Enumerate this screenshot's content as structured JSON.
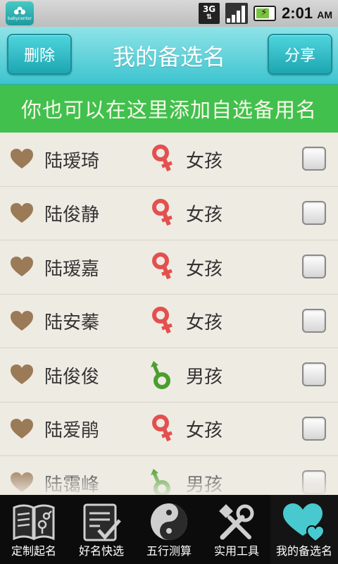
{
  "status": {
    "network": "3G",
    "time": "2:01",
    "ampm": "AM",
    "app_icon_text": "babycenter"
  },
  "header": {
    "delete_label": "删除",
    "title": "我的备选名",
    "share_label": "分享"
  },
  "banner": {
    "text": "你也可以在这里添加自选备用名"
  },
  "names": [
    {
      "name": "陆瑷琦",
      "gender": "女孩",
      "gender_icon": "female-symbol-icon",
      "checked": false
    },
    {
      "name": "陆俊静",
      "gender": "女孩",
      "gender_icon": "female-symbol-icon",
      "checked": false
    },
    {
      "name": "陆瑷嘉",
      "gender": "女孩",
      "gender_icon": "female-symbol-icon",
      "checked": false
    },
    {
      "name": "陆安蓁",
      "gender": "女孩",
      "gender_icon": "female-symbol-icon",
      "checked": false
    },
    {
      "name": "陆俊俊",
      "gender": "男孩",
      "gender_icon": "male-symbol-icon",
      "checked": false
    },
    {
      "name": "陆爱鹃",
      "gender": "女孩",
      "gender_icon": "female-symbol-icon",
      "checked": false
    },
    {
      "name": "陆霭峰",
      "gender": "男孩",
      "gender_icon": "male-symbol-icon",
      "checked": false
    }
  ],
  "nav": [
    {
      "label": "定制起名",
      "icon": "book-gender-icon"
    },
    {
      "label": "好名快选",
      "icon": "checklist-icon"
    },
    {
      "label": "五行测算",
      "icon": "yin-yang-icon"
    },
    {
      "label": "实用工具",
      "icon": "tools-icon"
    },
    {
      "label": "我的备选名",
      "icon": "hearts-icon",
      "active": true
    }
  ],
  "colors": {
    "accent": "#3cc4cf",
    "banner": "#41c04e",
    "heart": "#9b7a57",
    "female": "#e3504f",
    "male": "#4a9e2e"
  }
}
